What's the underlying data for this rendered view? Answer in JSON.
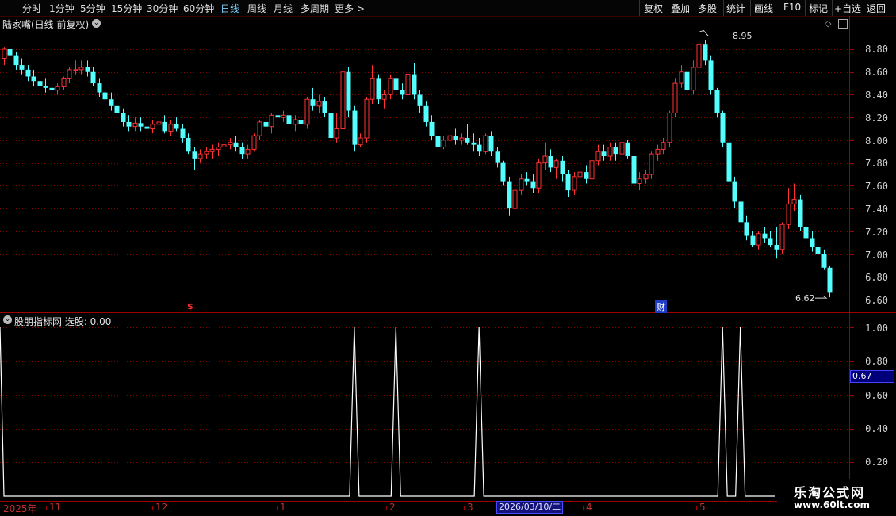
{
  "toolbar": {
    "periods": [
      "分时",
      "1分钟",
      "5分钟",
      "15分钟",
      "30分钟",
      "60分钟",
      "日线",
      "周线",
      "月线",
      "多周期",
      "更多 >"
    ],
    "active_period": "日线",
    "right_buttons": [
      "复权",
      "叠加",
      "多股",
      "统计",
      "画线",
      "F10",
      "标记",
      "+自选",
      "返回"
    ]
  },
  "main_panel": {
    "title": "陆家嘴(日线 前复权)",
    "y_labels": [
      "8.80",
      "8.60",
      "8.40",
      "8.20",
      "8.00",
      "7.80",
      "7.60",
      "7.40",
      "7.20",
      "7.00",
      "6.80",
      "6.60"
    ],
    "high_label": "8.95",
    "low_label": "6.62",
    "marker_s": "$",
    "marker_cai": "财"
  },
  "indicator_panel": {
    "title": "股朋指标网 选股: 0.00",
    "y_labels": [
      "1.00",
      "0.80",
      "0.60",
      "0.40",
      "0.20"
    ],
    "current_value": "0.67"
  },
  "time_axis": {
    "labels": [
      "2025年",
      "11",
      "12",
      "1",
      "2",
      "3",
      "4",
      "5"
    ],
    "cursor_date": "2026/03/10/二"
  },
  "watermark": {
    "line1": "乐淘公式网",
    "line2": "www.60lt.com"
  },
  "colors": {
    "up": "#ff3232",
    "down": "#54ffff",
    "grid": "#8b0000",
    "signal": "#ffffff"
  },
  "chart_data": {
    "type": "candlestick",
    "price_range": [
      6.55,
      8.98
    ],
    "candles": [
      [
        8.72,
        8.82,
        8.66,
        8.8
      ],
      [
        8.8,
        8.84,
        8.7,
        8.74
      ],
      [
        8.74,
        8.78,
        8.62,
        8.66
      ],
      [
        8.66,
        8.72,
        8.58,
        8.62
      ],
      [
        8.62,
        8.66,
        8.52,
        8.56
      ],
      [
        8.56,
        8.62,
        8.48,
        8.52
      ],
      [
        8.52,
        8.58,
        8.44,
        8.48
      ],
      [
        8.48,
        8.54,
        8.42,
        8.46
      ],
      [
        8.46,
        8.5,
        8.4,
        8.44
      ],
      [
        8.44,
        8.5,
        8.4,
        8.47
      ],
      [
        8.47,
        8.56,
        8.44,
        8.54
      ],
      [
        8.54,
        8.64,
        8.5,
        8.62
      ],
      [
        8.62,
        8.7,
        8.58,
        8.62
      ],
      [
        8.62,
        8.7,
        8.58,
        8.64
      ],
      [
        8.64,
        8.7,
        8.56,
        8.6
      ],
      [
        8.6,
        8.64,
        8.48,
        8.5
      ],
      [
        8.5,
        8.54,
        8.38,
        8.42
      ],
      [
        8.42,
        8.46,
        8.32,
        8.36
      ],
      [
        8.36,
        8.42,
        8.26,
        8.3
      ],
      [
        8.3,
        8.36,
        8.2,
        8.24
      ],
      [
        8.24,
        8.28,
        8.12,
        8.16
      ],
      [
        8.16,
        8.22,
        8.08,
        8.12
      ],
      [
        8.12,
        8.2,
        8.08,
        8.15
      ],
      [
        8.15,
        8.2,
        8.08,
        8.12
      ],
      [
        8.12,
        8.18,
        8.06,
        8.1
      ],
      [
        8.1,
        8.18,
        8.06,
        8.14
      ],
      [
        8.14,
        8.2,
        8.08,
        8.16
      ],
      [
        8.16,
        8.22,
        8.06,
        8.08
      ],
      [
        8.08,
        8.18,
        8.04,
        8.14
      ],
      [
        8.14,
        8.2,
        8.08,
        8.1
      ],
      [
        8.1,
        8.14,
        7.98,
        8.02
      ],
      [
        8.02,
        8.06,
        7.88,
        7.9
      ],
      [
        7.9,
        7.94,
        7.74,
        7.84
      ],
      [
        7.84,
        7.92,
        7.8,
        7.88
      ],
      [
        7.88,
        7.94,
        7.84,
        7.9
      ],
      [
        7.9,
        7.96,
        7.84,
        7.92
      ],
      [
        7.92,
        7.98,
        7.86,
        7.94
      ],
      [
        7.94,
        8.0,
        7.9,
        7.96
      ],
      [
        7.96,
        8.02,
        7.92,
        7.98
      ],
      [
        7.98,
        8.04,
        7.9,
        7.94
      ],
      [
        7.94,
        7.98,
        7.84,
        7.88
      ],
      [
        7.88,
        7.96,
        7.84,
        7.92
      ],
      [
        7.92,
        8.06,
        7.9,
        8.04
      ],
      [
        8.04,
        8.18,
        8.0,
        8.16
      ],
      [
        8.16,
        8.22,
        8.08,
        8.12
      ],
      [
        8.12,
        8.24,
        8.06,
        8.22
      ],
      [
        8.22,
        8.26,
        8.16,
        8.2
      ],
      [
        8.2,
        8.26,
        8.16,
        8.22
      ],
      [
        8.22,
        8.24,
        8.1,
        8.14
      ],
      [
        8.14,
        8.22,
        8.08,
        8.18
      ],
      [
        8.18,
        8.22,
        8.1,
        8.14
      ],
      [
        8.14,
        8.38,
        8.1,
        8.36
      ],
      [
        8.36,
        8.46,
        8.26,
        8.3
      ],
      [
        8.3,
        8.4,
        8.24,
        8.34
      ],
      [
        8.34,
        8.38,
        8.2,
        8.24
      ],
      [
        8.24,
        8.3,
        7.96,
        8.02
      ],
      [
        8.02,
        8.24,
        7.98,
        8.1
      ],
      [
        8.1,
        8.62,
        8.08,
        8.6
      ],
      [
        8.6,
        8.64,
        8.2,
        8.26
      ],
      [
        8.26,
        8.3,
        7.9,
        7.96
      ],
      [
        7.96,
        8.06,
        7.94,
        8.02
      ],
      [
        8.02,
        8.38,
        7.98,
        8.36
      ],
      [
        8.36,
        8.66,
        8.32,
        8.54
      ],
      [
        8.54,
        8.58,
        8.32,
        8.36
      ],
      [
        8.36,
        8.44,
        8.28,
        8.4
      ],
      [
        8.4,
        8.58,
        8.36,
        8.54
      ],
      [
        8.54,
        8.58,
        8.4,
        8.44
      ],
      [
        8.44,
        8.5,
        8.36,
        8.4
      ],
      [
        8.4,
        8.62,
        8.36,
        8.58
      ],
      [
        8.58,
        8.68,
        8.36,
        8.4
      ],
      [
        8.4,
        8.44,
        8.24,
        8.3
      ],
      [
        8.3,
        8.34,
        8.12,
        8.16
      ],
      [
        8.16,
        8.22,
        8.0,
        8.04
      ],
      [
        8.04,
        8.08,
        7.92,
        7.94
      ],
      [
        7.94,
        8.04,
        7.92,
        8.0
      ],
      [
        8.0,
        8.06,
        7.94,
        8.04
      ],
      [
        8.04,
        8.1,
        7.96,
        8.0
      ],
      [
        8.0,
        8.06,
        7.96,
        8.02
      ],
      [
        8.02,
        8.14,
        7.96,
        7.98
      ],
      [
        7.98,
        8.06,
        7.9,
        7.96
      ],
      [
        7.96,
        8.02,
        7.86,
        7.9
      ],
      [
        7.9,
        8.06,
        7.88,
        8.04
      ],
      [
        8.04,
        8.08,
        7.86,
        7.9
      ],
      [
        7.9,
        7.94,
        7.76,
        7.8
      ],
      [
        7.8,
        7.82,
        7.6,
        7.64
      ],
      [
        7.64,
        7.68,
        7.34,
        7.4
      ],
      [
        7.4,
        7.58,
        7.38,
        7.56
      ],
      [
        7.56,
        7.7,
        7.52,
        7.66
      ],
      [
        7.66,
        7.72,
        7.6,
        7.64
      ],
      [
        7.64,
        7.7,
        7.54,
        7.58
      ],
      [
        7.58,
        7.84,
        7.54,
        7.8
      ],
      [
        7.8,
        7.98,
        7.74,
        7.86
      ],
      [
        7.86,
        7.92,
        7.72,
        7.76
      ],
      [
        7.76,
        7.84,
        7.66,
        7.82
      ],
      [
        7.82,
        7.86,
        7.64,
        7.7
      ],
      [
        7.7,
        7.74,
        7.5,
        7.56
      ],
      [
        7.56,
        7.72,
        7.52,
        7.68
      ],
      [
        7.68,
        7.74,
        7.62,
        7.72
      ],
      [
        7.72,
        7.78,
        7.62,
        7.66
      ],
      [
        7.66,
        7.84,
        7.64,
        7.82
      ],
      [
        7.82,
        7.96,
        7.78,
        7.9
      ],
      [
        7.9,
        7.96,
        7.82,
        7.86
      ],
      [
        7.86,
        7.98,
        7.82,
        7.94
      ],
      [
        7.94,
        7.98,
        7.82,
        7.88
      ],
      [
        7.88,
        8.0,
        7.84,
        7.98
      ],
      [
        7.98,
        8.0,
        7.84,
        7.86
      ],
      [
        7.86,
        7.88,
        7.6,
        7.62
      ],
      [
        7.62,
        7.72,
        7.56,
        7.66
      ],
      [
        7.66,
        7.74,
        7.62,
        7.7
      ],
      [
        7.7,
        7.9,
        7.66,
        7.88
      ],
      [
        7.88,
        7.96,
        7.82,
        7.92
      ],
      [
        7.92,
        8.02,
        7.88,
        7.98
      ],
      [
        7.98,
        8.26,
        7.94,
        8.24
      ],
      [
        8.24,
        8.54,
        8.2,
        8.5
      ],
      [
        8.5,
        8.66,
        8.46,
        8.6
      ],
      [
        8.6,
        8.68,
        8.4,
        8.44
      ],
      [
        8.44,
        8.7,
        8.4,
        8.64
      ],
      [
        8.64,
        8.95,
        8.6,
        8.84
      ],
      [
        8.84,
        8.88,
        8.66,
        8.7
      ],
      [
        8.7,
        8.74,
        8.4,
        8.44
      ],
      [
        8.44,
        8.46,
        8.2,
        8.24
      ],
      [
        8.24,
        8.26,
        7.94,
        7.98
      ],
      [
        7.98,
        8.02,
        7.6,
        7.64
      ],
      [
        7.64,
        7.68,
        7.4,
        7.46
      ],
      [
        7.46,
        7.5,
        7.24,
        7.28
      ],
      [
        7.28,
        7.34,
        7.12,
        7.16
      ],
      [
        7.16,
        7.2,
        7.06,
        7.08
      ],
      [
        7.08,
        7.2,
        7.04,
        7.18
      ],
      [
        7.18,
        7.24,
        7.1,
        7.14
      ],
      [
        7.14,
        7.2,
        7.06,
        7.08
      ],
      [
        7.08,
        7.24,
        6.96,
        7.04
      ],
      [
        7.04,
        7.28,
        7.0,
        7.26
      ],
      [
        7.26,
        7.58,
        7.22,
        7.44
      ],
      [
        7.44,
        7.62,
        7.38,
        7.48
      ],
      [
        7.48,
        7.52,
        7.2,
        7.24
      ],
      [
        7.24,
        7.28,
        7.1,
        7.14
      ],
      [
        7.14,
        7.2,
        7.02,
        7.06
      ],
      [
        7.06,
        7.1,
        6.96,
        7.0
      ],
      [
        7.0,
        7.04,
        6.86,
        6.88
      ],
      [
        6.88,
        6.9,
        6.62,
        6.66
      ]
    ],
    "signal": {
      "ylim": [
        0,
        1
      ],
      "spikes_at_candle_index": [
        0,
        59,
        66,
        80,
        121,
        124
      ],
      "value": 1
    }
  }
}
